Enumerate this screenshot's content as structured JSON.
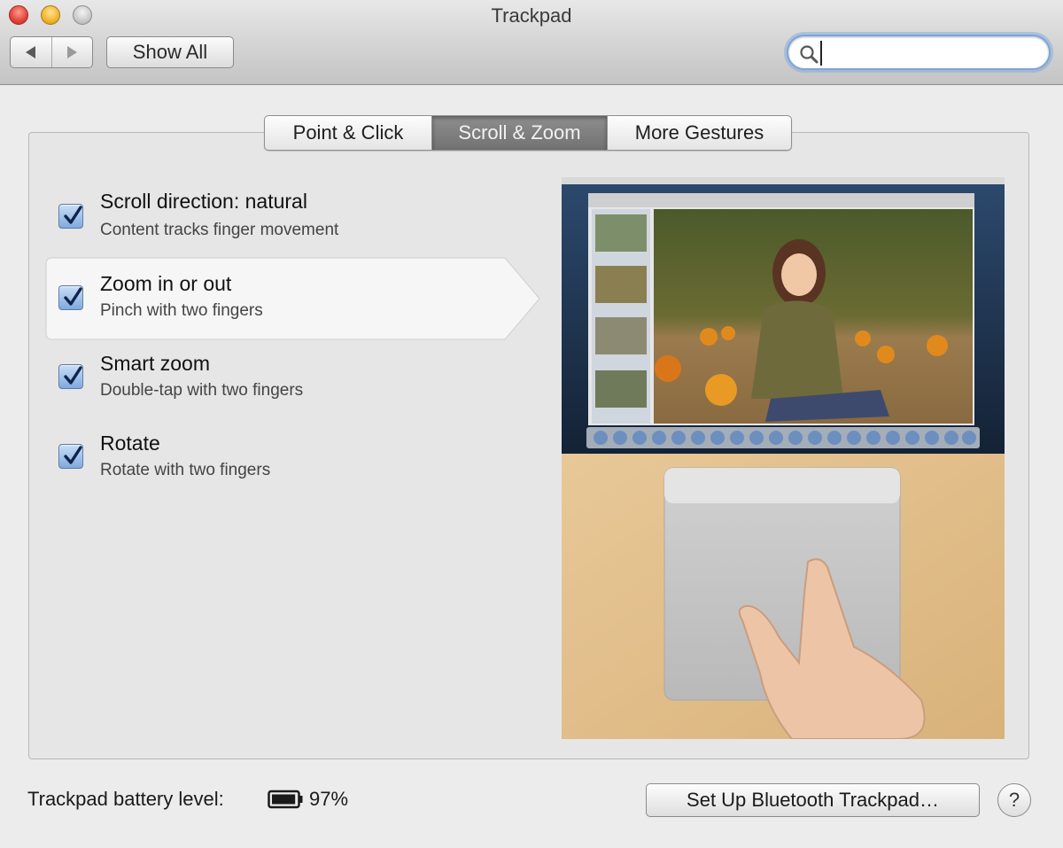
{
  "window": {
    "title": "Trackpad"
  },
  "toolbar": {
    "show_all_label": "Show All"
  },
  "search": {
    "placeholder": "",
    "value": ""
  },
  "tabs": [
    {
      "label": "Point & Click",
      "selected": false
    },
    {
      "label": "Scroll & Zoom",
      "selected": true
    },
    {
      "label": "More Gestures",
      "selected": false
    }
  ],
  "options": [
    {
      "title": "Scroll direction: natural",
      "subtitle": "Content tracks finger movement",
      "checked": true,
      "highlighted": false
    },
    {
      "title": "Zoom in or out",
      "subtitle": "Pinch with two fingers",
      "checked": true,
      "highlighted": true
    },
    {
      "title": "Smart zoom",
      "subtitle": "Double-tap with two fingers",
      "checked": true,
      "highlighted": false
    },
    {
      "title": "Rotate",
      "subtitle": "Rotate with two fingers",
      "checked": true,
      "highlighted": false
    }
  ],
  "footer": {
    "battery_label": "Trackpad battery level:",
    "battery_value": "97%",
    "battery_level": 0.97,
    "setup_button_label": "Set Up Bluetooth Trackpad…",
    "help_label": "?"
  },
  "colors": {
    "checkbox_blue": "#7fa9df",
    "selected_tab": "#7f7f7f",
    "desk_wood": "#e2bf8c",
    "focus_ring": "#7ca6db"
  }
}
